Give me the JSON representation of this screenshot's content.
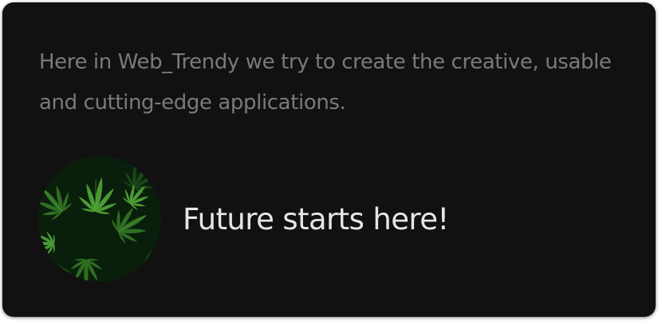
{
  "card": {
    "intro_text": "Here in Web_Trendy we try to create the creative, usable and cutting-edge applications.",
    "tagline": "Future starts here!",
    "avatar": {
      "icon": "cannabis-leaves-image"
    }
  },
  "colors": {
    "card_background": "#111111",
    "intro_text": "#7a7a7a",
    "tagline_text": "#e6e6e6",
    "leaf_green": "#3f8f2a"
  }
}
